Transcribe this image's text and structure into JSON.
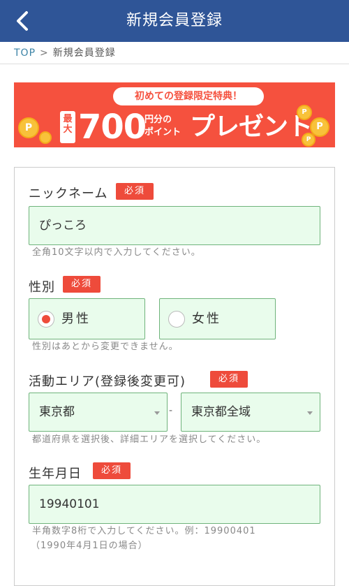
{
  "header": {
    "title": "新規会員登録"
  },
  "breadcrumb": {
    "top": "TOP",
    "sep": ">",
    "current": "新規会員登録"
  },
  "banner": {
    "pill": "初めての登録限定特典！",
    "saidai": "最大",
    "amount": "700",
    "unit_line1": "円分の",
    "unit_line2": "ポイント",
    "word": "プレゼント",
    "coin_glyph": "P"
  },
  "form": {
    "required_label": "必須",
    "nickname": {
      "label": "ニックネーム",
      "value": "ぴっころ",
      "help": "全角10文字以内で入力してください。"
    },
    "gender": {
      "label": "性別",
      "options": [
        "男性",
        "女性"
      ],
      "selected": "男性",
      "help": "性別はあとから変更できません。"
    },
    "area": {
      "label": "活動エリア(登録後変更可)",
      "prefecture": "東京都",
      "detail": "東京都全域",
      "separator": "-",
      "help": "都道府県を選択後、詳細エリアを選択してください。"
    },
    "birthday": {
      "label": "生年月日",
      "value": "19940101",
      "help_line1": "半角数字8桁で入力してください。例：19900401",
      "help_line2": "（1990年4月1日の場合）"
    }
  },
  "colors": {
    "header_bg": "#2f5597",
    "banner_bg": "#f5513e",
    "required_bg": "#ee4b3b",
    "field_bg": "#e9fcec",
    "field_border": "#6fb37b"
  }
}
